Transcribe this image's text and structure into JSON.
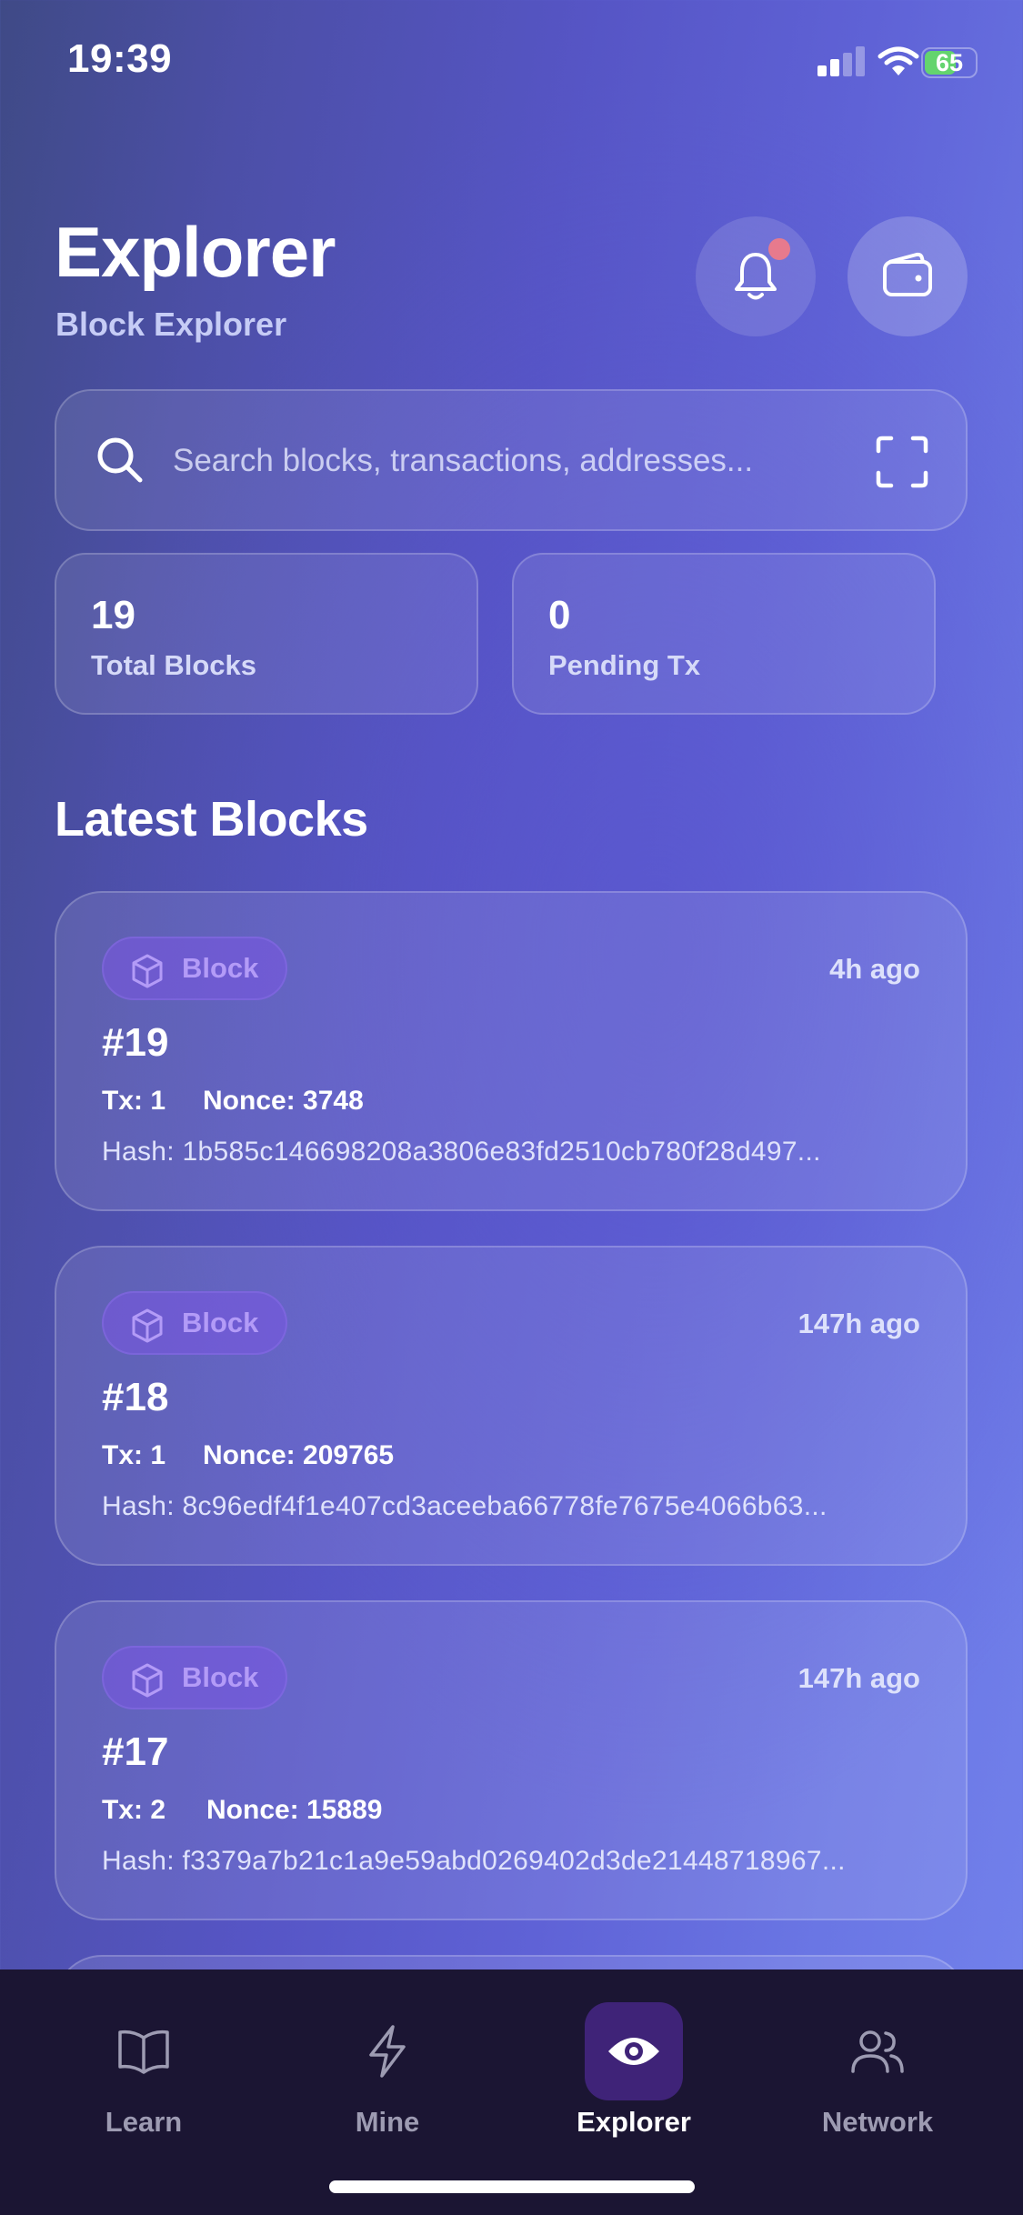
{
  "status_bar": {
    "time": "19:39",
    "battery": "65",
    "battery_level": 0.65
  },
  "header": {
    "title": "Explorer",
    "subtitle": "Block Explorer",
    "notification_icon": "bell-icon",
    "wallet_icon": "wallet-icon",
    "notification_dot_color": "#e77a8d"
  },
  "search": {
    "placeholder": "Search blocks, transactions, addresses...",
    "value": "",
    "search_icon": "search-icon",
    "scan_icon": "scan-icon"
  },
  "stats": [
    {
      "value": "19",
      "label": "Total Blocks"
    },
    {
      "value": "0",
      "label": "Pending Tx"
    }
  ],
  "latest_blocks": {
    "title": "Latest Blocks",
    "badge_color": "#b39bf7",
    "blocks": [
      {
        "badge": "Block",
        "time": "4h ago",
        "number": "#19",
        "tx": "Tx: 1",
        "nonce": "Nonce: 3748",
        "hash": "Hash: 1b585c146698208a3806e83fd2510cb780f28d497..."
      },
      {
        "badge": "Block",
        "time": "147h ago",
        "number": "#18",
        "tx": "Tx: 1",
        "nonce": "Nonce: 209765",
        "hash": "Hash: 8c96edf4f1e407cd3aceeba66778fe7675e4066b63..."
      },
      {
        "badge": "Block",
        "time": "147h ago",
        "number": "#17",
        "tx": "Tx: 2",
        "nonce": "Nonce: 15889",
        "hash": "Hash: f3379a7b21c1a9e59abd0269402d3de21448718967..."
      }
    ]
  },
  "tabs": [
    {
      "label": "Learn",
      "icon": "book-icon",
      "active": false
    },
    {
      "label": "Mine",
      "icon": "lightning-icon",
      "active": false
    },
    {
      "label": "Explorer",
      "icon": "eye-icon",
      "active": true
    },
    {
      "label": "Network",
      "icon": "users-icon",
      "active": false
    }
  ],
  "theme": {
    "accent": "#5655c5",
    "tabbar_background": "#1b1533",
    "active_tab_background": "#3f2378"
  }
}
